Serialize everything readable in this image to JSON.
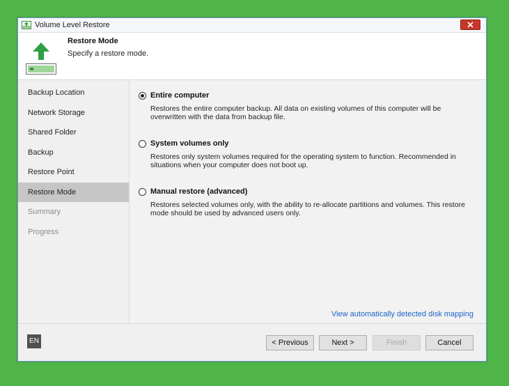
{
  "window": {
    "title": "Volume Level Restore"
  },
  "header": {
    "title": "Restore Mode",
    "subtitle": "Specify a restore mode."
  },
  "sidebar": {
    "items": [
      {
        "label": "Backup Location",
        "state": "done"
      },
      {
        "label": "Network Storage",
        "state": "done"
      },
      {
        "label": "Shared Folder",
        "state": "done"
      },
      {
        "label": "Backup",
        "state": "done"
      },
      {
        "label": "Restore Point",
        "state": "done"
      },
      {
        "label": "Restore Mode",
        "state": "active"
      },
      {
        "label": "Summary",
        "state": "pending"
      },
      {
        "label": "Progress",
        "state": "pending"
      }
    ]
  },
  "options": [
    {
      "label": "Entire computer",
      "description": "Restores the entire computer backup. All data on existing volumes of this computer will be overwritten with the data from backup file.",
      "checked": true
    },
    {
      "label": "System volumes only",
      "description": "Restores only system volumes required for the operating system to function. Recommended in situations when your computer does not boot up.",
      "checked": false
    },
    {
      "label": "Manual restore (advanced)",
      "description": "Restores selected volumes only, with the ability to re-allocate partitions and volumes. This restore mode should be used by advanced users only.",
      "checked": false
    }
  ],
  "link": {
    "label": "View automatically detected disk mapping"
  },
  "footer": {
    "language": "EN",
    "previous_label": "< Previous",
    "next_label": "Next >",
    "finish_label": "Finish",
    "cancel_label": "Cancel"
  },
  "colors": {
    "background": "#4fb548",
    "accent_green": "#2ea043",
    "close_red": "#c7372b",
    "link_blue": "#1a64c8",
    "active_step": "#c6c6c6"
  },
  "icons": {
    "title": "restore-app-icon",
    "header": "green-up-arrow-icon",
    "close": "close-icon"
  }
}
